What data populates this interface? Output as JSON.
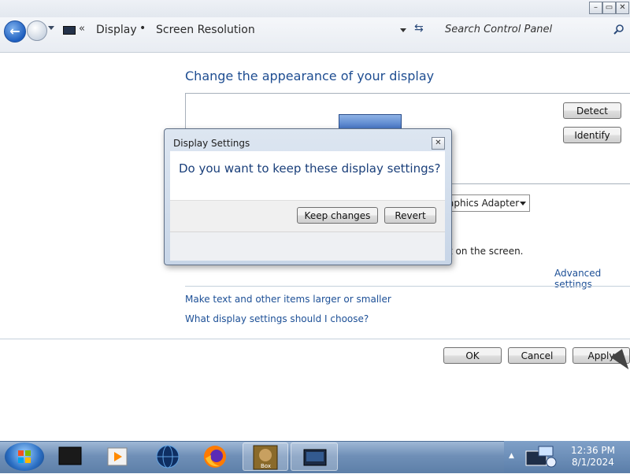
{
  "window": {
    "controls": {
      "minimize": "–",
      "maximize": "▭",
      "close": "✕"
    }
  },
  "address_bar": {
    "breadcrumbs": [
      "Display",
      "Screen Resolution"
    ],
    "overflow_chevron": "«",
    "refresh_glyph": "⇆",
    "search_placeholder": "Search Control Panel"
  },
  "main": {
    "heading": "Change the appearance of your display",
    "detect_label": "Detect",
    "identify_label": "Identify",
    "display_combo_value": "aphics Adapter",
    "partial_text": "t on the screen.",
    "advanced_link": "Advanced settings",
    "links": [
      "Make text and other items larger or smaller",
      "What display settings should I choose?"
    ],
    "ok_label": "OK",
    "cancel_label": "Cancel",
    "apply_label": "Apply"
  },
  "dialog": {
    "title": "Display Settings",
    "close_glyph": "✕",
    "question": "Do you want to keep these display settings?",
    "keep_label": "Keep changes",
    "revert_label": "Revert"
  },
  "taskbar": {
    "apps": [
      "screen-app",
      "media-player-app",
      "network-globe-app",
      "firefox-app",
      "box-game-app",
      "display-app"
    ],
    "tray_arrow": "▲",
    "time": "12:36 PM",
    "date": "8/1/2024"
  },
  "colors": {
    "link": "#1c4f96",
    "heading": "#1e4d91",
    "taskbar": "#6f8fb7"
  }
}
